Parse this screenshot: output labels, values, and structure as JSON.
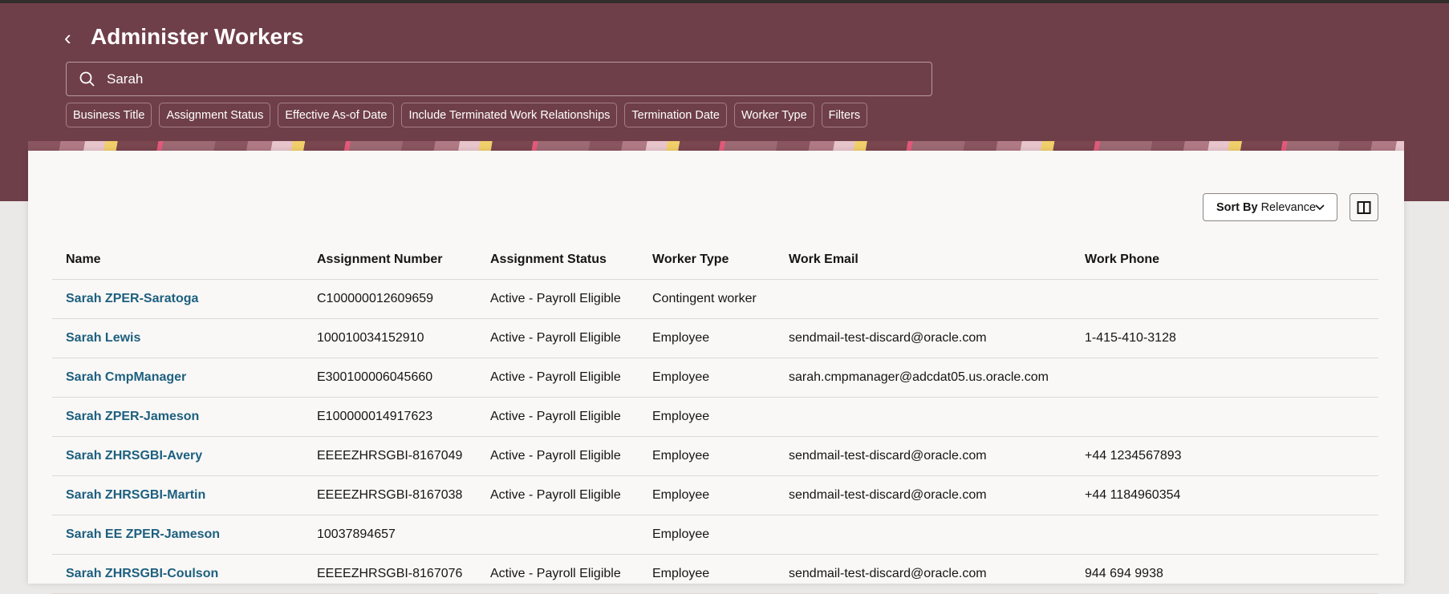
{
  "header": {
    "title": "Administer Workers",
    "back_icon": "chevron-left-icon"
  },
  "search": {
    "value": "Sarah",
    "icon": "search-icon"
  },
  "chips": [
    "Business Title",
    "Assignment Status",
    "Effective As-of Date",
    "Include Terminated Work Relationships",
    "Termination Date",
    "Worker Type",
    "Filters"
  ],
  "sort": {
    "label": "Sort By",
    "value": "Relevance"
  },
  "table": {
    "columns": [
      "Name",
      "Assignment Number",
      "Assignment Status",
      "Worker Type",
      "Work Email",
      "Work Phone"
    ],
    "rows": [
      [
        "Sarah ZPER-Saratoga",
        "C100000012609659",
        "Active - Payroll Eligible",
        "Contingent worker",
        "",
        ""
      ],
      [
        "Sarah Lewis",
        "100010034152910",
        "Active - Payroll Eligible",
        "Employee",
        "sendmail-test-discard@oracle.com",
        "1-415-410-3128"
      ],
      [
        "Sarah CmpManager",
        "E300100006045660",
        "Active - Payroll Eligible",
        "Employee",
        "sarah.cmpmanager@adcdat05.us.oracle.com",
        ""
      ],
      [
        "Sarah ZPER-Jameson",
        "E100000014917623",
        "Active - Payroll Eligible",
        "Employee",
        "",
        ""
      ],
      [
        "Sarah ZHRSGBI-Avery",
        "EEEEZHRSGBI-8167049",
        "Active - Payroll Eligible",
        "Employee",
        "sendmail-test-discard@oracle.com",
        "+44 1234567893"
      ],
      [
        "Sarah ZHRSGBI-Martin",
        "EEEEZHRSGBI-8167038",
        "Active - Payroll Eligible",
        "Employee",
        "sendmail-test-discard@oracle.com",
        "+44 1184960354"
      ],
      [
        "Sarah EE ZPER-Jameson",
        "10037894657",
        "",
        "Employee",
        "",
        ""
      ],
      [
        "Sarah ZHRSGBI-Coulson",
        "EEEEZHRSGBI-8167076",
        "Active - Payroll Eligible",
        "Employee",
        "sendmail-test-discard@oracle.com",
        "944 694 9938"
      ]
    ]
  }
}
